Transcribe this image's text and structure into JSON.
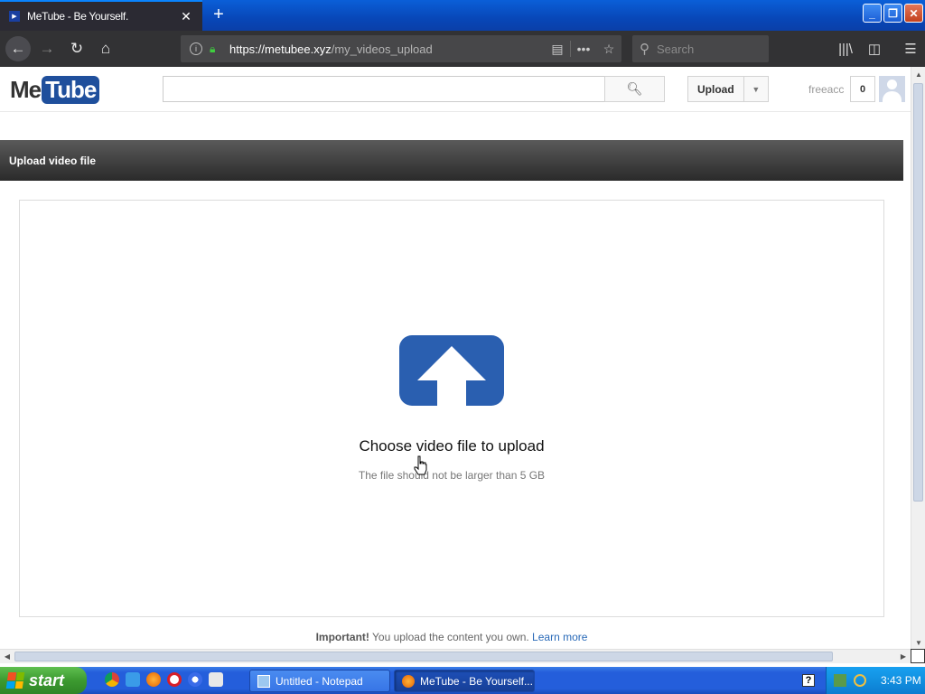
{
  "browser": {
    "tab_title": "MeTube - Be Yourself.",
    "tab_favicon": "▶",
    "url_host": "https://metubee.xyz",
    "url_path": "/my_videos_upload",
    "search_placeholder": "Search"
  },
  "site": {
    "logo_me": "Me",
    "logo_tube": "Tube",
    "search_value": "",
    "upload_label": "Upload",
    "username": "freeacc",
    "notification_count": "0"
  },
  "upload": {
    "section_title": "Upload video file",
    "choose_label": "Choose video file to upload",
    "limit_text": "The file should not be larger than 5 GB",
    "important_bold": "Important!",
    "important_text": " You upload the content you own. ",
    "learn_more": "Learn more"
  },
  "taskbar": {
    "start_label": "start",
    "tasks": [
      {
        "label": "Untitled - Notepad"
      },
      {
        "label": "MeTube - Be Yourself..."
      }
    ],
    "clock": "3:43 PM"
  },
  "colors": {
    "brand_blue": "#1f4f9c",
    "link": "#2a6ab8",
    "upload_icon": "#2a5fb0"
  }
}
